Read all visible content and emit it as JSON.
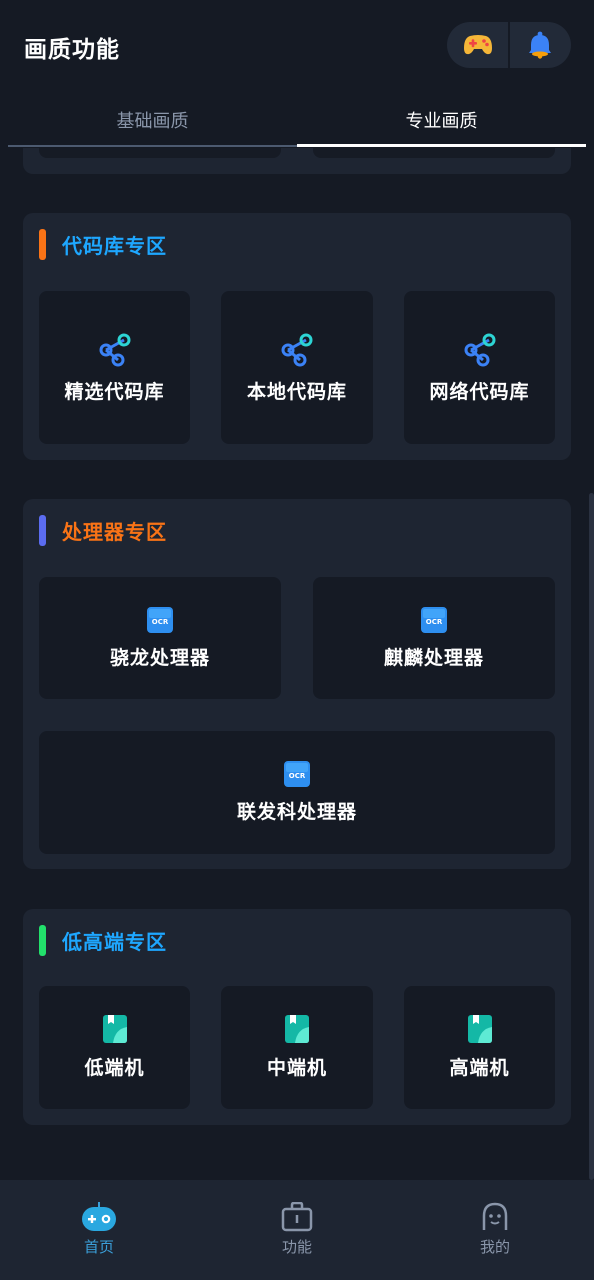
{
  "header": {
    "title": "画质功能",
    "actions": [
      {
        "icon": "gamepad-icon"
      },
      {
        "icon": "bell-icon"
      }
    ]
  },
  "tabs": [
    {
      "label": "基础画质",
      "active": false
    },
    {
      "label": "专业画质",
      "active": true
    }
  ],
  "sections": [
    {
      "title": "代码库专区",
      "accent_color": "#f97316",
      "title_color": "#1ea7ff",
      "items": [
        {
          "label": "精选代码库",
          "icon": "share-nodes-icon"
        },
        {
          "label": "本地代码库",
          "icon": "share-nodes-icon"
        },
        {
          "label": "网络代码库",
          "icon": "share-nodes-icon"
        }
      ]
    },
    {
      "title": "处理器专区",
      "accent_color": "#5b6cf0",
      "title_color": "#f97316",
      "icon_text": "OCR",
      "items": [
        {
          "label": "骁龙处理器",
          "icon": "ocr-icon"
        },
        {
          "label": "麒麟处理器",
          "icon": "ocr-icon"
        },
        {
          "label": "联发科处理器",
          "icon": "ocr-icon"
        }
      ]
    },
    {
      "title": "低高端专区",
      "accent_color": "#22e06b",
      "title_color": "#1ea7ff",
      "items": [
        {
          "label": "低端机",
          "icon": "book-icon"
        },
        {
          "label": "中端机",
          "icon": "book-icon"
        },
        {
          "label": "高端机",
          "icon": "book-icon"
        }
      ]
    }
  ],
  "bottom_nav": [
    {
      "label": "首页",
      "icon": "robot-icon",
      "active": true,
      "color": "#3b9fd9"
    },
    {
      "label": "功能",
      "icon": "toolbox-icon",
      "active": false,
      "color": "#8a96aa"
    },
    {
      "label": "我的",
      "icon": "smiley-icon",
      "active": false,
      "color": "#8a96aa"
    }
  ],
  "colors": {
    "background": "#151a24",
    "card": "#1e2532",
    "tile": "#151a24",
    "accent_blue": "#1ea7ff"
  }
}
